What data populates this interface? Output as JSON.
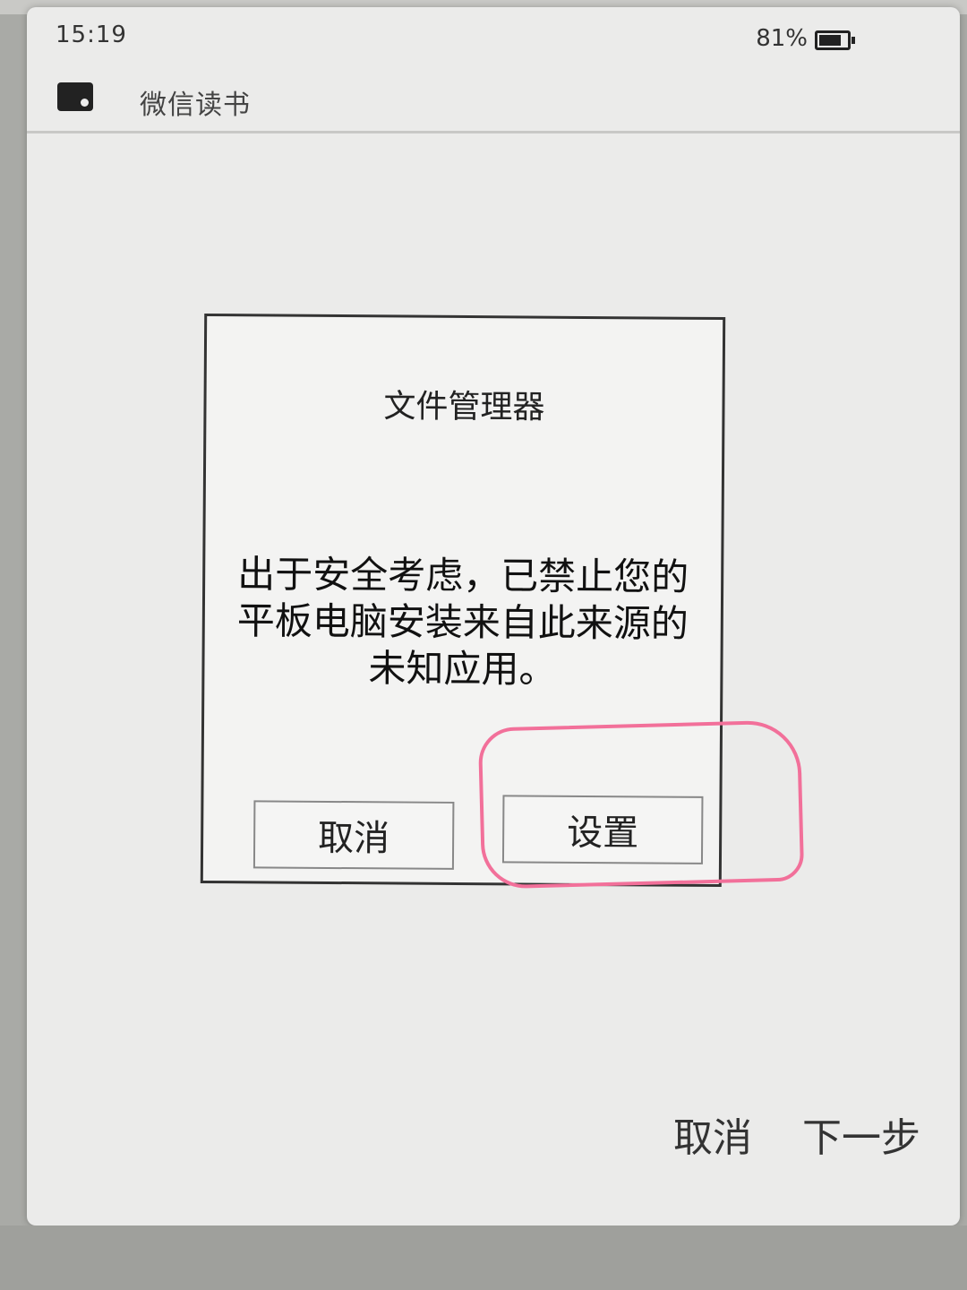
{
  "status_bar": {
    "time": "15:19",
    "battery_percent": "81%",
    "battery_icon": "battery-icon"
  },
  "header": {
    "app_icon": "book-icon",
    "app_title": "微信读书"
  },
  "dialog": {
    "title": "文件管理器",
    "message": "出于安全考虑，已禁止您的平板电脑安装来自此来源的未知应用。",
    "cancel_label": "取消",
    "settings_label": "设置"
  },
  "footer": {
    "cancel_label": "取消",
    "next_label": "下一步"
  },
  "colors": {
    "screen_background": "#ebebea",
    "highlight_annotation": "#f2709a"
  }
}
